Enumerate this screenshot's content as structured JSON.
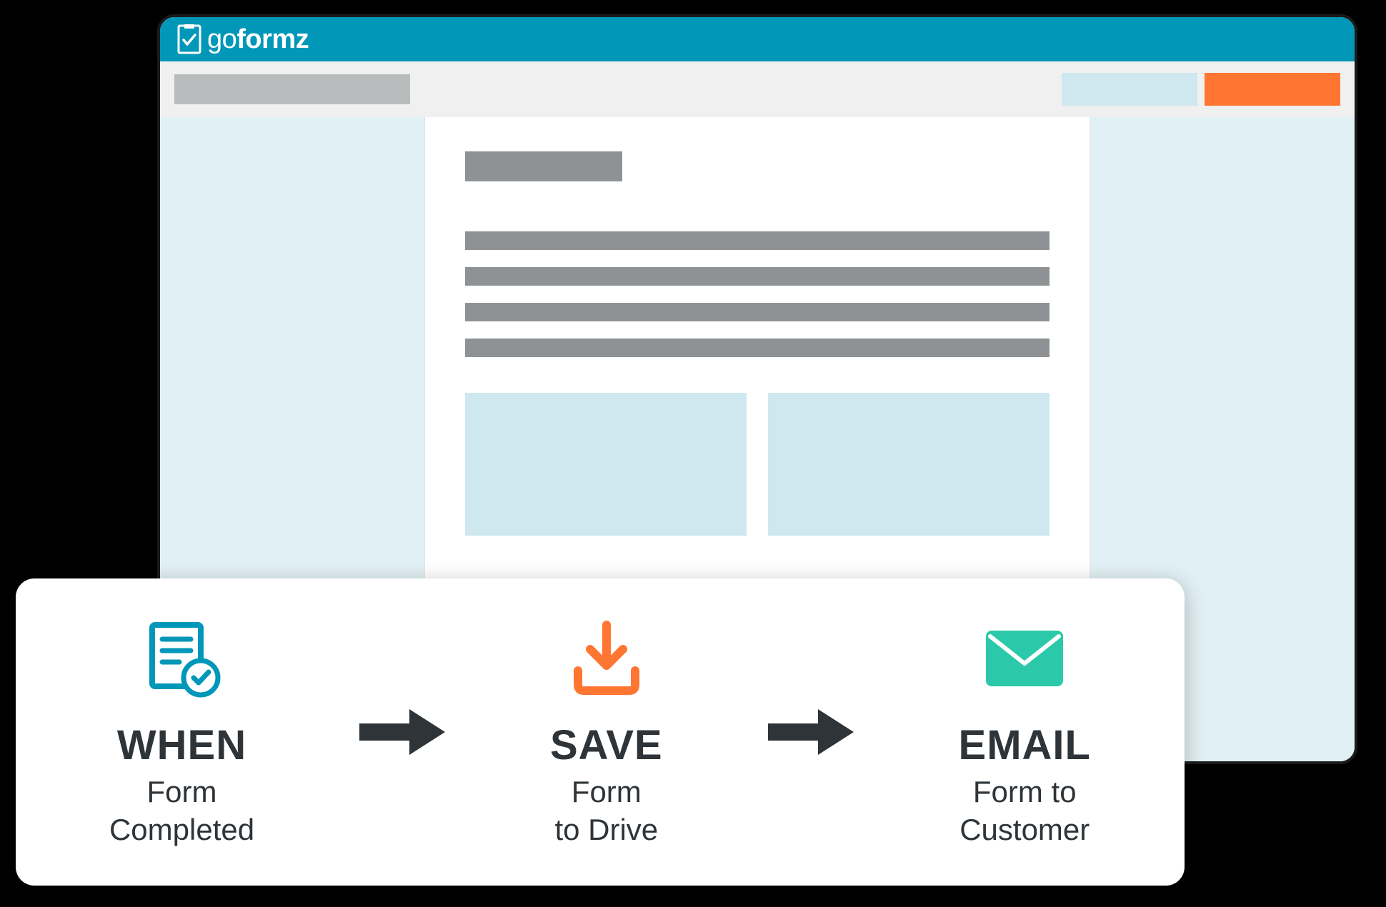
{
  "brand": {
    "name_light": "go",
    "name_bold": "formz"
  },
  "workflow": {
    "steps": [
      {
        "title": "WHEN",
        "line1": "Form",
        "line2": "Completed",
        "icon": "form-check-icon",
        "icon_color": "#0197b8"
      },
      {
        "title": "SAVE",
        "line1": "Form",
        "line2": "to Drive",
        "icon": "download-icon",
        "icon_color": "#ff7633"
      },
      {
        "title": "EMAIL",
        "line1": "Form to",
        "line2": "Customer",
        "icon": "envelope-icon",
        "icon_color": "#2bc9a9"
      }
    ]
  },
  "colors": {
    "brand_teal": "#0197b8",
    "accent_orange": "#ff7633",
    "accent_green": "#2bc9a9",
    "light_blue": "#cfe7ee",
    "panel_blue": "#e1f0f4",
    "placeholder_gray": "#8f9294",
    "dark_text": "#2e3438"
  }
}
